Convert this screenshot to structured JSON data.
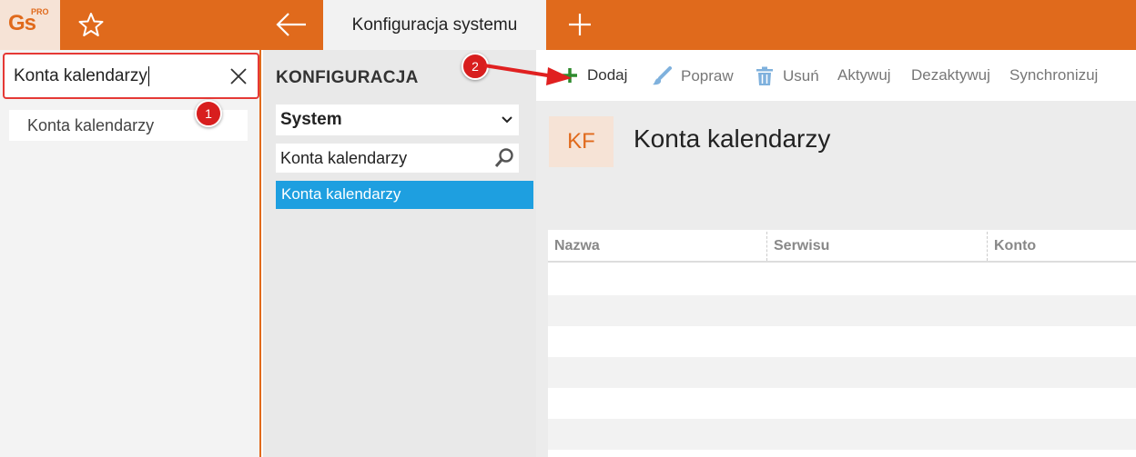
{
  "app": {
    "logo": "Gs",
    "logo_suffix": "PRO",
    "active_tab": "Konfiguracja systemu"
  },
  "left": {
    "search_value": "Konta kalendarzy",
    "results": [
      "Konta kalendarzy"
    ]
  },
  "badges": {
    "one": "1",
    "two": "2"
  },
  "middle": {
    "title": "KONFIGURACJA",
    "select_value": "System",
    "search_value": "Konta kalendarzy",
    "items": [
      "Konta kalendarzy"
    ]
  },
  "toolbar": {
    "add": "Dodaj",
    "edit": "Popraw",
    "delete": "Usuń",
    "activate": "Aktywuj",
    "deactivate": "Dezaktywuj",
    "sync": "Synchronizuj"
  },
  "main": {
    "icon_text": "KF",
    "title": "Konta kalendarzy",
    "columns": [
      "Nazwa",
      "Serwisu",
      "Konto"
    ]
  },
  "colors": {
    "accent": "#e06a1c",
    "selected": "#1e9fe0",
    "badge": "#d81e1e",
    "add_icon": "#2e8b2e"
  }
}
